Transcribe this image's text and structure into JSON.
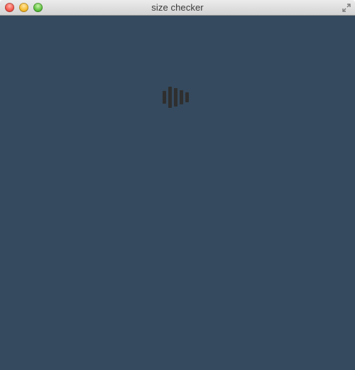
{
  "window": {
    "title": "size checker",
    "controls": {
      "close_icon": "close-icon",
      "minimize_icon": "minimize-icon",
      "zoom_icon": "zoom-icon",
      "fullscreen_icon": "fullscreen-icon"
    }
  },
  "content": {
    "background": "#354a5e",
    "loading_indicator_icon": "activity-bars-icon"
  },
  "colors": {
    "titlebar_top": "#ececec",
    "titlebar_bottom": "#d3d3d3",
    "spinner": "#2f2f2f"
  }
}
